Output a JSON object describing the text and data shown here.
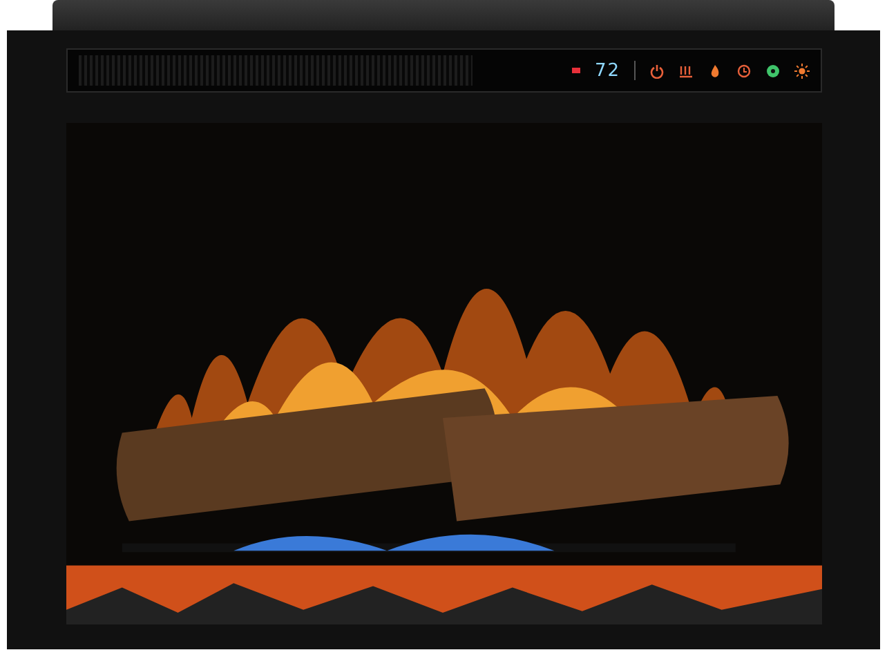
{
  "control_panel": {
    "indicator_on": true,
    "display": "72",
    "buttons": [
      {
        "kind": "power",
        "color": "#e8603a"
      },
      {
        "kind": "heat",
        "color": "#e8603a"
      },
      {
        "kind": "flame",
        "color": "#f07a30"
      },
      {
        "kind": "timer",
        "color": "#e8603a"
      },
      {
        "kind": "color",
        "color": "#3fc46a"
      },
      {
        "kind": "brightness",
        "color": "#f07a30"
      }
    ]
  }
}
